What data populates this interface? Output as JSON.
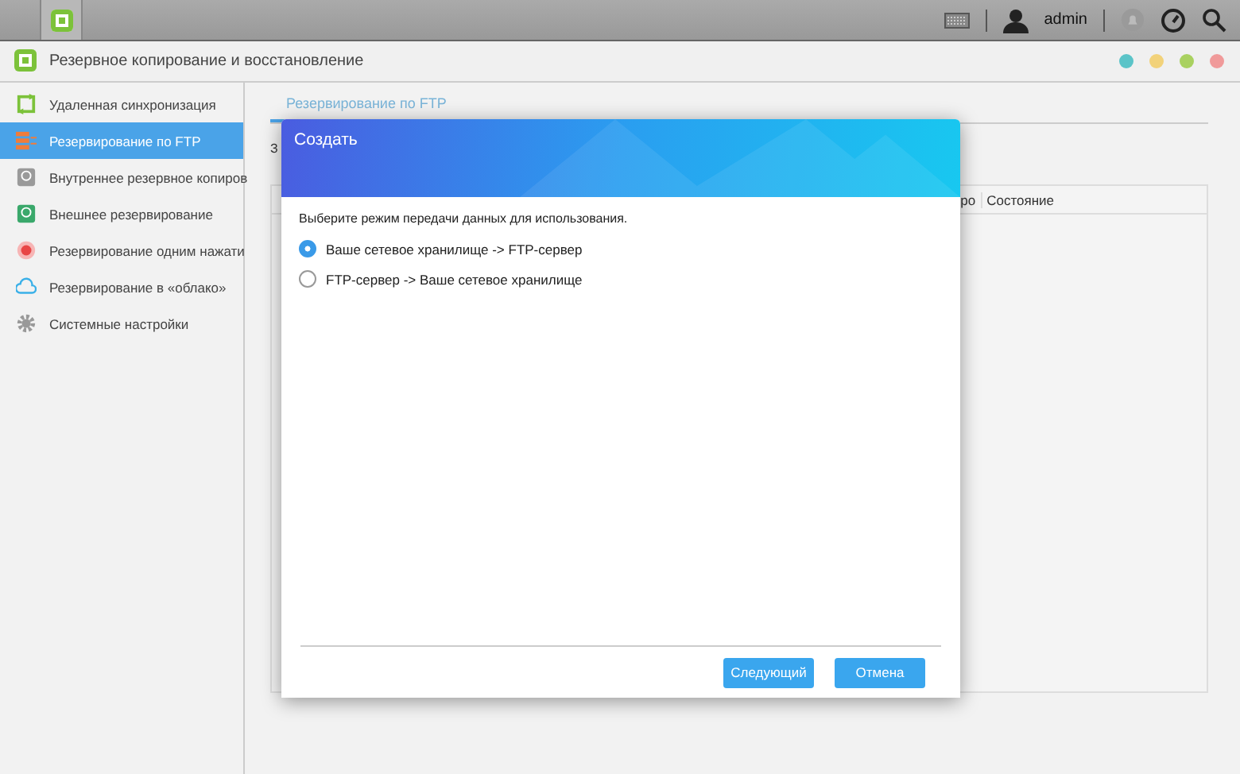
{
  "top_bar": {
    "user": "admin"
  },
  "window": {
    "title": "Резервное копирование и восстановление",
    "controls": [
      {
        "color": "#5bc4c8"
      },
      {
        "color": "#f2d27a"
      },
      {
        "color": "#a9d160"
      },
      {
        "color": "#f09a9a"
      }
    ]
  },
  "sidebar": {
    "items": [
      {
        "label": "Удаленная синхронизация",
        "kind": "sync",
        "selected": false
      },
      {
        "label": "Резервирование по FTP",
        "kind": "ftp",
        "selected": true
      },
      {
        "label": "Внутреннее резервное копиров",
        "kind": "disk",
        "selected": false
      },
      {
        "label": "Внешнее резервирование",
        "kind": "external",
        "selected": false
      },
      {
        "label": "Резервирование одним нажати",
        "kind": "onetouch",
        "selected": false
      },
      {
        "label": "Резервирование в «облако»",
        "kind": "cloud",
        "selected": false
      },
      {
        "label": "Системные настройки",
        "kind": "gear",
        "selected": false
      }
    ]
  },
  "tabs": [
    {
      "label": "Резервирование по FTP",
      "selected": true
    }
  ],
  "description": "З",
  "table": {
    "columns": [
      {
        "label": "ро"
      },
      {
        "label": "Состояние"
      }
    ]
  },
  "dialog": {
    "title": "Создать",
    "prompt": "Выберите режим передачи данных для использования.",
    "options": [
      {
        "label": "Ваше сетевое хранилище -> FTP-сервер",
        "selected": true
      },
      {
        "label": "FTP-сервер -> Ваше сетевое хранилище",
        "selected": false
      }
    ],
    "buttons": [
      "Следующий",
      "Отмена"
    ]
  }
}
